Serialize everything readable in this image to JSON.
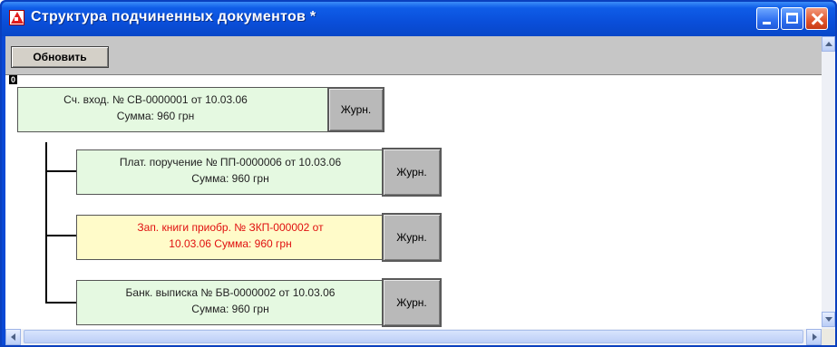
{
  "window": {
    "title": "Структура подчиненных документов  *",
    "accent_color": "#0a4ed9",
    "close_color": "#e0542b"
  },
  "toolbar": {
    "refresh_label": "Обновить"
  },
  "tree": {
    "root_marker": "0",
    "root": {
      "line1": "Сч. вход. № СВ-0000001 от 10.03.06",
      "line2": "Сумма: 960 грн",
      "journal_label": "Журн.",
      "status_color": "#e5f9e1"
    },
    "children": [
      {
        "line1": "Плат. поручение № ПП-0000006 от 10.03.06",
        "line2": "Сумма: 960 грн",
        "journal_label": "Журн.",
        "status_color": "#e5f9e1"
      },
      {
        "line1": "Зап. книги приобр. № ЗКП-000002 от",
        "line2": "10.03.06  Сумма: 960 грн",
        "journal_label": "Журн.",
        "status_color": "#fffbc9",
        "text_color": "#e01010"
      },
      {
        "line1": "Банк. выписка № БВ-0000002 от 10.03.06",
        "line2": "Сумма: 960 грн",
        "journal_label": "Журн.",
        "status_color": "#e5f9e1"
      }
    ]
  },
  "icons": {
    "app": "app-triangle-icon",
    "minimize": "minimize-icon",
    "maximize": "maximize-icon",
    "close": "close-icon",
    "scroll_up": "scroll-up-arrow-icon",
    "scroll_down": "scroll-down-arrow-icon",
    "scroll_left": "scroll-left-arrow-icon",
    "scroll_right": "scroll-right-arrow-icon"
  }
}
